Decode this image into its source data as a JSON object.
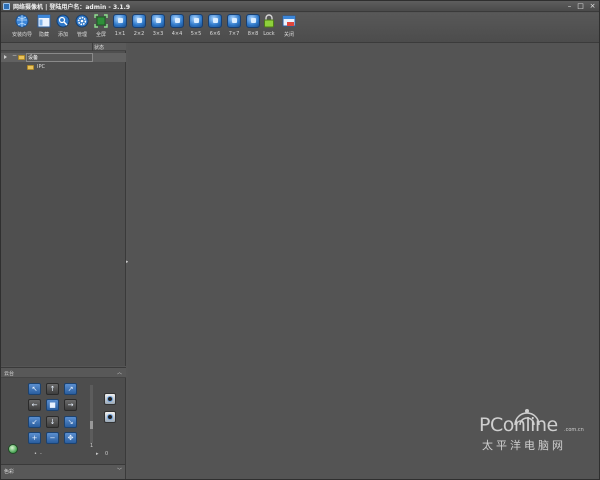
{
  "window": {
    "title": "网络摄像机 | 登陆用户名：admin - 3.1.9",
    "controls": {
      "minimize": "–",
      "maximize": "□",
      "close": "×"
    }
  },
  "toolbar": {
    "items": [
      {
        "label": "安装向导",
        "icon": "globe-wizard-icon"
      },
      {
        "label": "隐藏",
        "icon": "window-hide-icon"
      },
      {
        "label": "添加",
        "icon": "search-add-icon"
      },
      {
        "label": "管理",
        "icon": "gear-icon"
      },
      {
        "label": "全屏",
        "icon": "fullscreen-icon"
      },
      {
        "label": "1×1",
        "icon": "layout-icon"
      },
      {
        "label": "2×2",
        "icon": "layout-icon"
      },
      {
        "label": "3×3",
        "icon": "layout-icon"
      },
      {
        "label": "4×4",
        "icon": "layout-icon"
      },
      {
        "label": "5×5",
        "icon": "layout-icon"
      },
      {
        "label": "6×6",
        "icon": "layout-icon"
      },
      {
        "label": "7×7",
        "icon": "layout-icon"
      },
      {
        "label": "8×8",
        "icon": "layout-icon"
      },
      {
        "label": "Lock",
        "icon": "lock-icon"
      },
      {
        "label": "关闭",
        "icon": "close-window-icon"
      }
    ]
  },
  "tree": {
    "status_header": "状态",
    "root": {
      "label": "设备",
      "expand": "−"
    },
    "child": {
      "label": "IPC"
    }
  },
  "ptz": {
    "title": "云台",
    "collapse": "︿",
    "buttons": {
      "up_left": "↖",
      "up": "↑",
      "up_right": "↗",
      "left": "←",
      "center": "■",
      "right": "→",
      "down_left": "↙",
      "down": "↓",
      "down_right": "↘",
      "zoom_in": "+",
      "zoom_out": "−",
      "auto": "✥"
    },
    "speed_value": "1",
    "preset_value": "0",
    "minus": "-",
    "dot": "•"
  },
  "color": {
    "title": "色彩",
    "collapse": "﹀"
  },
  "splitter": "▸",
  "watermark": {
    "logo": "PConline",
    "domain": ".com.cn",
    "cn": "太平洋电脑网"
  },
  "colors": {
    "accent": "#2e78c9",
    "background": "#545454",
    "panel": "#4f4f4f"
  }
}
